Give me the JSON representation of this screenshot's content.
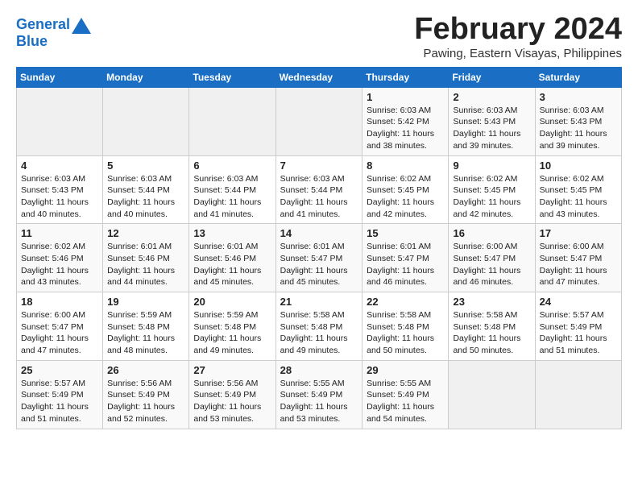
{
  "header": {
    "logo_line1": "General",
    "logo_line2": "Blue",
    "month_title": "February 2024",
    "subtitle": "Pawing, Eastern Visayas, Philippines"
  },
  "weekdays": [
    "Sunday",
    "Monday",
    "Tuesday",
    "Wednesday",
    "Thursday",
    "Friday",
    "Saturday"
  ],
  "weeks": [
    [
      {
        "day": "",
        "info": ""
      },
      {
        "day": "",
        "info": ""
      },
      {
        "day": "",
        "info": ""
      },
      {
        "day": "",
        "info": ""
      },
      {
        "day": "1",
        "info": "Sunrise: 6:03 AM\nSunset: 5:42 PM\nDaylight: 11 hours\nand 38 minutes."
      },
      {
        "day": "2",
        "info": "Sunrise: 6:03 AM\nSunset: 5:43 PM\nDaylight: 11 hours\nand 39 minutes."
      },
      {
        "day": "3",
        "info": "Sunrise: 6:03 AM\nSunset: 5:43 PM\nDaylight: 11 hours\nand 39 minutes."
      }
    ],
    [
      {
        "day": "4",
        "info": "Sunrise: 6:03 AM\nSunset: 5:43 PM\nDaylight: 11 hours\nand 40 minutes."
      },
      {
        "day": "5",
        "info": "Sunrise: 6:03 AM\nSunset: 5:44 PM\nDaylight: 11 hours\nand 40 minutes."
      },
      {
        "day": "6",
        "info": "Sunrise: 6:03 AM\nSunset: 5:44 PM\nDaylight: 11 hours\nand 41 minutes."
      },
      {
        "day": "7",
        "info": "Sunrise: 6:03 AM\nSunset: 5:44 PM\nDaylight: 11 hours\nand 41 minutes."
      },
      {
        "day": "8",
        "info": "Sunrise: 6:02 AM\nSunset: 5:45 PM\nDaylight: 11 hours\nand 42 minutes."
      },
      {
        "day": "9",
        "info": "Sunrise: 6:02 AM\nSunset: 5:45 PM\nDaylight: 11 hours\nand 42 minutes."
      },
      {
        "day": "10",
        "info": "Sunrise: 6:02 AM\nSunset: 5:45 PM\nDaylight: 11 hours\nand 43 minutes."
      }
    ],
    [
      {
        "day": "11",
        "info": "Sunrise: 6:02 AM\nSunset: 5:46 PM\nDaylight: 11 hours\nand 43 minutes."
      },
      {
        "day": "12",
        "info": "Sunrise: 6:01 AM\nSunset: 5:46 PM\nDaylight: 11 hours\nand 44 minutes."
      },
      {
        "day": "13",
        "info": "Sunrise: 6:01 AM\nSunset: 5:46 PM\nDaylight: 11 hours\nand 45 minutes."
      },
      {
        "day": "14",
        "info": "Sunrise: 6:01 AM\nSunset: 5:47 PM\nDaylight: 11 hours\nand 45 minutes."
      },
      {
        "day": "15",
        "info": "Sunrise: 6:01 AM\nSunset: 5:47 PM\nDaylight: 11 hours\nand 46 minutes."
      },
      {
        "day": "16",
        "info": "Sunrise: 6:00 AM\nSunset: 5:47 PM\nDaylight: 11 hours\nand 46 minutes."
      },
      {
        "day": "17",
        "info": "Sunrise: 6:00 AM\nSunset: 5:47 PM\nDaylight: 11 hours\nand 47 minutes."
      }
    ],
    [
      {
        "day": "18",
        "info": "Sunrise: 6:00 AM\nSunset: 5:47 PM\nDaylight: 11 hours\nand 47 minutes."
      },
      {
        "day": "19",
        "info": "Sunrise: 5:59 AM\nSunset: 5:48 PM\nDaylight: 11 hours\nand 48 minutes."
      },
      {
        "day": "20",
        "info": "Sunrise: 5:59 AM\nSunset: 5:48 PM\nDaylight: 11 hours\nand 49 minutes."
      },
      {
        "day": "21",
        "info": "Sunrise: 5:58 AM\nSunset: 5:48 PM\nDaylight: 11 hours\nand 49 minutes."
      },
      {
        "day": "22",
        "info": "Sunrise: 5:58 AM\nSunset: 5:48 PM\nDaylight: 11 hours\nand 50 minutes."
      },
      {
        "day": "23",
        "info": "Sunrise: 5:58 AM\nSunset: 5:48 PM\nDaylight: 11 hours\nand 50 minutes."
      },
      {
        "day": "24",
        "info": "Sunrise: 5:57 AM\nSunset: 5:49 PM\nDaylight: 11 hours\nand 51 minutes."
      }
    ],
    [
      {
        "day": "25",
        "info": "Sunrise: 5:57 AM\nSunset: 5:49 PM\nDaylight: 11 hours\nand 51 minutes."
      },
      {
        "day": "26",
        "info": "Sunrise: 5:56 AM\nSunset: 5:49 PM\nDaylight: 11 hours\nand 52 minutes."
      },
      {
        "day": "27",
        "info": "Sunrise: 5:56 AM\nSunset: 5:49 PM\nDaylight: 11 hours\nand 53 minutes."
      },
      {
        "day": "28",
        "info": "Sunrise: 5:55 AM\nSunset: 5:49 PM\nDaylight: 11 hours\nand 53 minutes."
      },
      {
        "day": "29",
        "info": "Sunrise: 5:55 AM\nSunset: 5:49 PM\nDaylight: 11 hours\nand 54 minutes."
      },
      {
        "day": "",
        "info": ""
      },
      {
        "day": "",
        "info": ""
      }
    ]
  ]
}
